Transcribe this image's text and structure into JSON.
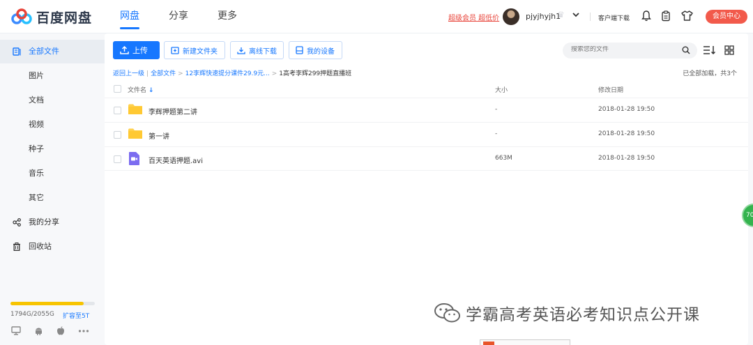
{
  "header": {
    "logo_text": "百度网盘",
    "nav": [
      {
        "label": "网盘",
        "active": true
      },
      {
        "label": "分享",
        "active": false
      },
      {
        "label": "更多",
        "active": false
      }
    ],
    "super_vip_link": "超级会员 超低价",
    "username": "pjyjhyjh1",
    "client_download": "客户端下载",
    "vip_center": "会员中心",
    "colors": {
      "accent": "#1677ff",
      "vip": "#f25a4b"
    }
  },
  "sidebar": {
    "items": [
      {
        "label": "全部文件",
        "icon": "files-icon",
        "active": true
      },
      {
        "label": "图片",
        "icon": "",
        "active": false
      },
      {
        "label": "文档",
        "icon": "",
        "active": false
      },
      {
        "label": "视频",
        "icon": "",
        "active": false
      },
      {
        "label": "种子",
        "icon": "",
        "active": false
      },
      {
        "label": "音乐",
        "icon": "",
        "active": false
      },
      {
        "label": "其它",
        "icon": "",
        "active": false
      },
      {
        "label": "我的分享",
        "icon": "share-icon",
        "active": false
      },
      {
        "label": "回收站",
        "icon": "trash-icon",
        "active": false
      }
    ],
    "storage": {
      "text": "1794G/2055G",
      "used_fraction": 0.87,
      "expand": "扩容至5T"
    }
  },
  "toolbar": {
    "upload": "上传",
    "new_folder": "新建文件夹",
    "offline_download": "离线下载",
    "my_devices": "我的设备",
    "search_placeholder": "搜索您的文件"
  },
  "breadcrumb": {
    "back": "返回上一级",
    "items": [
      "全部文件",
      "12李辉快速提分课件29.9元..."
    ],
    "current": "1高考李辉299押题直播班"
  },
  "load_status": "已全部加载，共3个",
  "columns": {
    "name": "文件名",
    "size": "大小",
    "modified": "修改日期"
  },
  "files": [
    {
      "name": "李辉押题第二讲",
      "type": "folder",
      "size": "-",
      "modified": "2018-01-28 19:50"
    },
    {
      "name": "第一讲",
      "type": "folder",
      "size": "-",
      "modified": "2018-01-28 19:50"
    },
    {
      "name": "百天英语押题.avi",
      "type": "video",
      "size": "663M",
      "modified": "2018-01-28 19:50"
    }
  ],
  "float_ball": "70",
  "watermark": "学霸高考英语必考知识点公开课"
}
